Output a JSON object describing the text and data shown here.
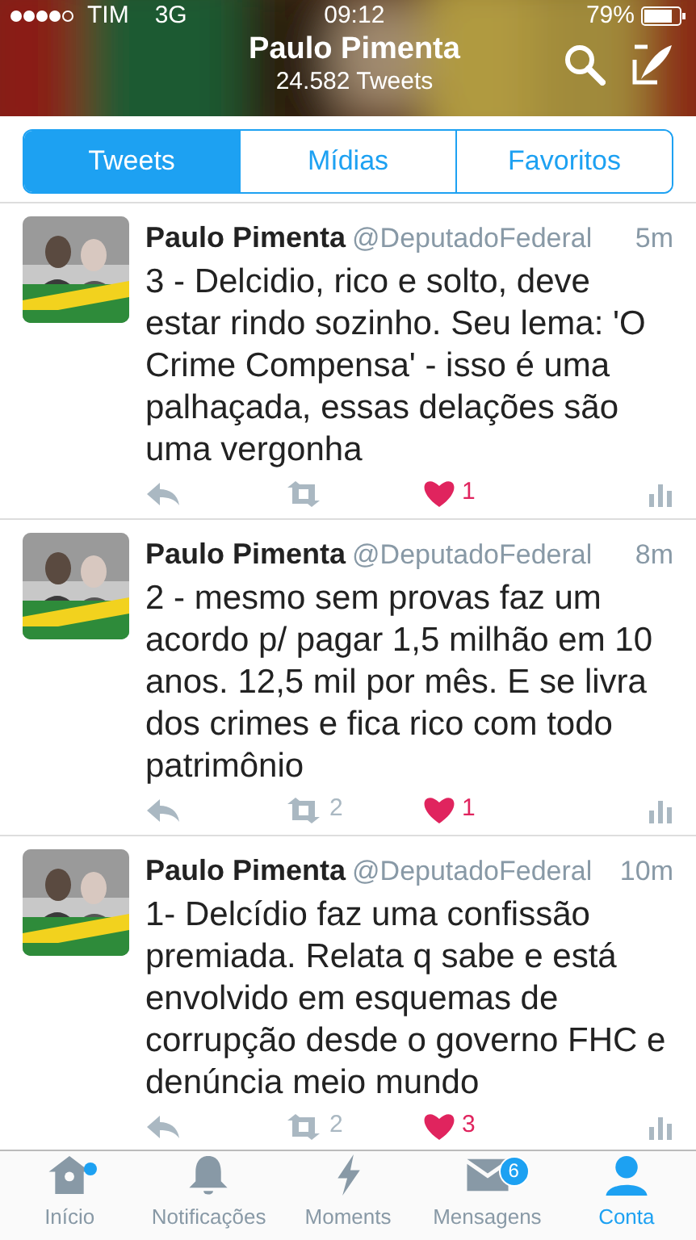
{
  "status_bar": {
    "carrier": "TIM",
    "network": "3G",
    "time": "09:12",
    "battery": "79%"
  },
  "header": {
    "title": "Paulo Pimenta",
    "subtitle": "24.582 Tweets"
  },
  "tabs": [
    {
      "label": "Tweets",
      "selected": true
    },
    {
      "label": "Mídias",
      "selected": false
    },
    {
      "label": "Favoritos",
      "selected": false
    }
  ],
  "tweets": [
    {
      "name": "Paulo Pimenta",
      "handle": "@DeputadoFederal",
      "time": "5m",
      "text": "3 - Delcidio, rico e solto, deve estar rindo sozinho. Seu lema:  'O Crime Compensa' - isso é uma palhaçada, essas delações são uma vergonha",
      "liked": true,
      "likes": "1"
    },
    {
      "name": "Paulo Pimenta",
      "handle": "@DeputadoFederal",
      "time": "8m",
      "text": "2 - mesmo sem provas faz um acordo p/ pagar 1,5 milhão em 10 anos. 12,5 mil por mês. E se livra dos crimes e fica rico com todo patrimônio",
      "retweets": "2",
      "liked": true,
      "likes": "1"
    },
    {
      "name": "Paulo Pimenta",
      "handle": "@DeputadoFederal",
      "time": "10m",
      "text": "1- Delcídio faz uma confissão premiada. Relata q sabe e está envolvido em esquemas de corrupção desde o governo FHC e denúncia meio mundo",
      "retweets": "2",
      "liked": true,
      "likes": "3"
    }
  ],
  "tab_bar": [
    {
      "kind": "home",
      "label": "Início",
      "selected": false,
      "dot": true
    },
    {
      "kind": "bell",
      "label": "Notificações",
      "selected": false
    },
    {
      "kind": "bolt",
      "label": "Moments",
      "selected": false
    },
    {
      "kind": "mail",
      "label": "Mensagens",
      "selected": false,
      "badge": "6"
    },
    {
      "kind": "person",
      "label": "Conta",
      "selected": true
    }
  ]
}
